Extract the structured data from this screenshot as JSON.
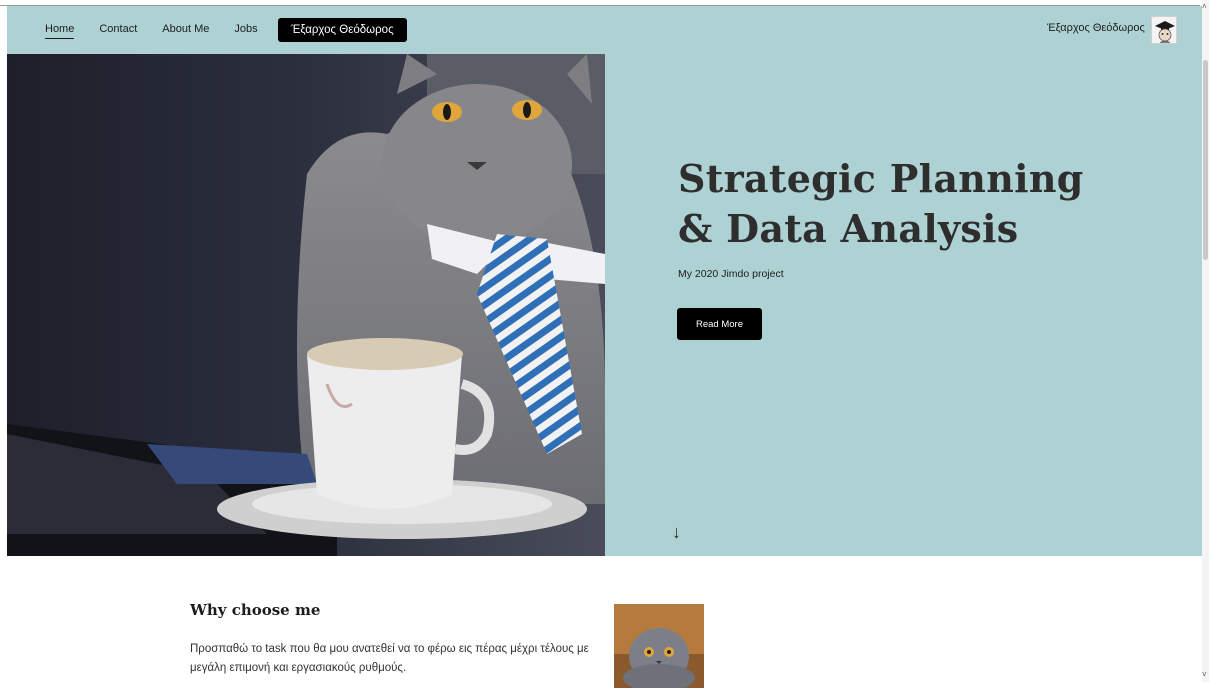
{
  "nav": {
    "items": [
      {
        "label": "Home",
        "active": true
      },
      {
        "label": "Contact",
        "active": false
      },
      {
        "label": "About Me",
        "active": false
      },
      {
        "label": "Jobs",
        "active": false
      }
    ],
    "brand_button": "Έξαρχος Θεόδωρος"
  },
  "user": {
    "name": "Έξαρχος Θεόδωρος",
    "avatar_icon": "graduate-avatar-icon"
  },
  "hero": {
    "title": "Strategic Planning & Data Analysis",
    "subtitle": "My 2020 Jimdo project",
    "button": "Read More",
    "scroll_icon": "↓",
    "image_icon": "cat-in-tie-photo"
  },
  "section": {
    "title": "Why choose me",
    "lines": [
      "Προσπαθώ το task που θα μου ανατεθεί να το φέρω εις πέρας μέχρι τέλους με",
      "μεγάλη επιμονή και εργασιακούς ρυθμούς."
    ],
    "thumb_icon": "cat-thumbnail-photo"
  },
  "colors": {
    "accent_bg": "#aed2d3",
    "button_bg": "#000000"
  }
}
